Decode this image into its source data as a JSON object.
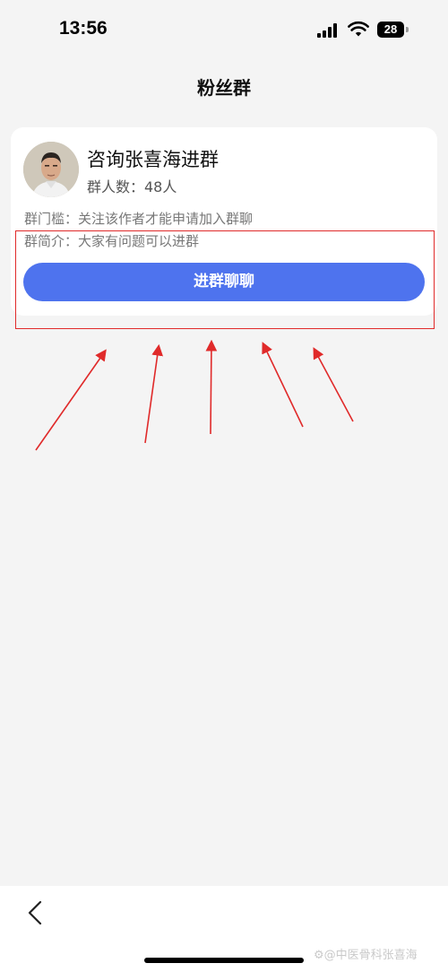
{
  "status_bar": {
    "time": "13:56",
    "battery_level": "28"
  },
  "header": {
    "title": "粉丝群"
  },
  "group": {
    "name": "咨询张喜海进群",
    "member_count": "群人数：48人",
    "threshold": "群门槛：关注该作者才能申请加入群聊",
    "intro": "群简介：大家有问题可以进群",
    "join_button_label": "进群聊聊"
  },
  "watermark": "⚙@中医骨科张喜海",
  "colors": {
    "accent": "#4e73ee",
    "annotation": "#e02a2a",
    "background": "#f4f4f4"
  },
  "icons": {
    "back": "chevron-left-icon",
    "signal": "cellular-signal-icon",
    "wifi": "wifi-icon",
    "battery": "battery-icon"
  }
}
